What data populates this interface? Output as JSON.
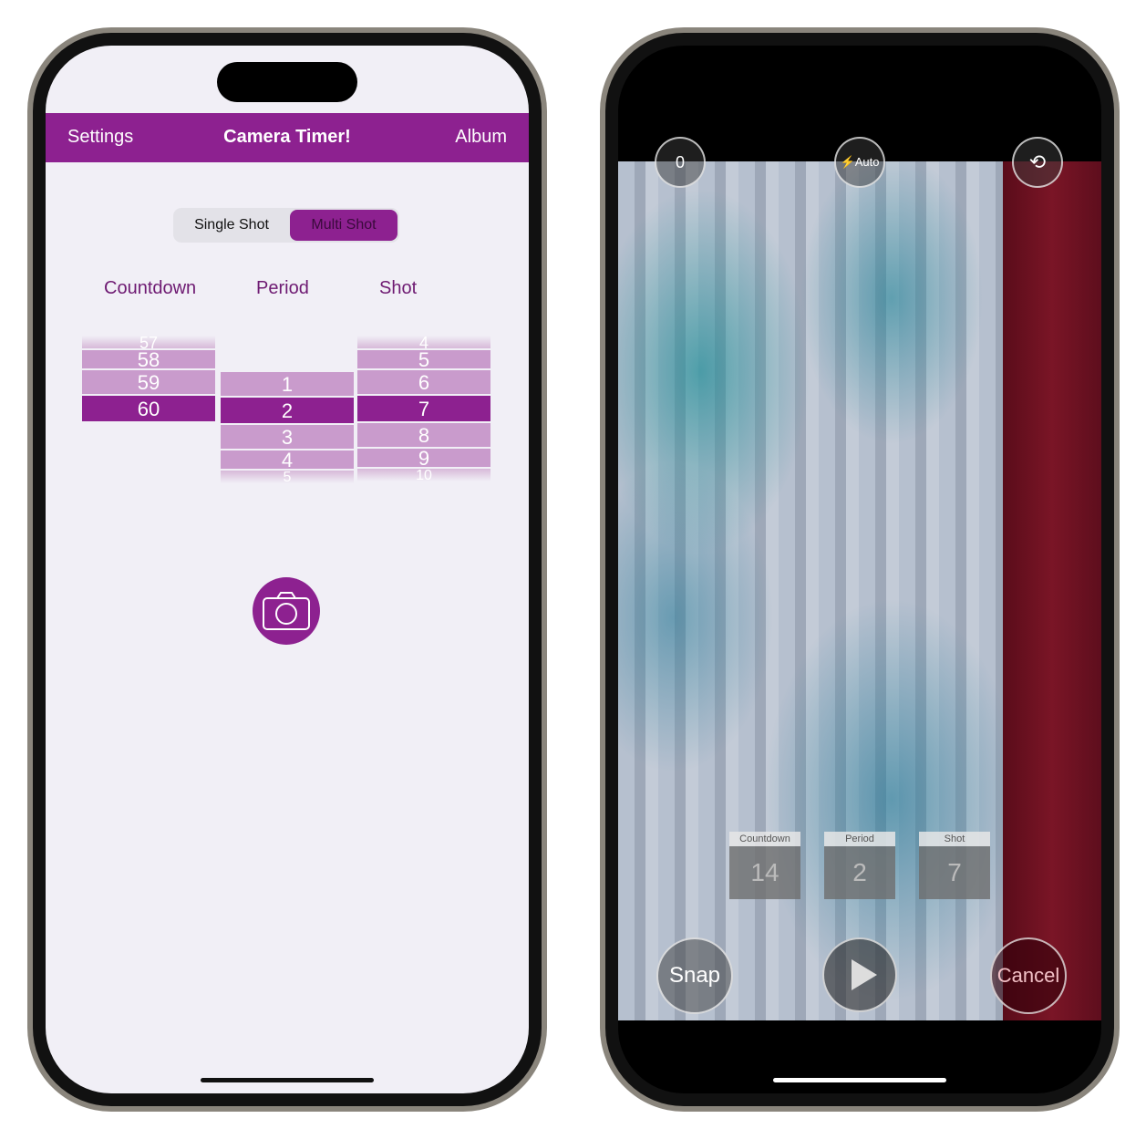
{
  "left": {
    "nav": {
      "settings": "Settings",
      "title": "Camera Timer!",
      "album": "Album"
    },
    "segment": {
      "options": [
        "Single Shot",
        "Multi Shot"
      ],
      "selected": "Multi Shot"
    },
    "columns": [
      "Countdown",
      "Period",
      "Shot"
    ],
    "pickers": {
      "countdown": {
        "values": [
          "57",
          "58",
          "59",
          "60"
        ],
        "selected": "60"
      },
      "period": {
        "values": [
          "1",
          "2",
          "3",
          "4",
          "5"
        ],
        "selected": "2"
      },
      "shot": {
        "values": [
          "4",
          "5",
          "6",
          "7",
          "8",
          "9",
          "10"
        ],
        "selected": "7"
      }
    },
    "shutter_icon": "camera-icon"
  },
  "right": {
    "top": {
      "counter": "0",
      "flash": "Auto",
      "flip_icon": "camera-flip-icon"
    },
    "status": {
      "countdown_label": "Countdown",
      "countdown": "14",
      "period_label": "Period",
      "period": "2",
      "shot_label": "Shot",
      "shot": "7"
    },
    "buttons": {
      "snap": "Snap",
      "play_icon": "play-icon",
      "cancel": "Cancel"
    }
  },
  "colors": {
    "accent": "#8d2190",
    "background": "#f1eff6"
  }
}
